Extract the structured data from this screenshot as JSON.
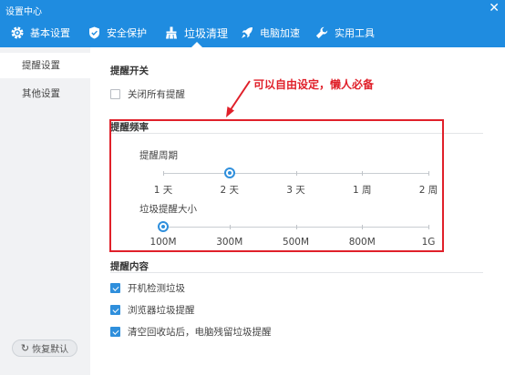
{
  "window": {
    "title": "设置中心",
    "close_glyph": "✕"
  },
  "tabs": [
    {
      "label": "基本设置",
      "icon": "gear-icon"
    },
    {
      "label": "安全保护",
      "icon": "shield-icon"
    },
    {
      "label": "垃圾清理",
      "icon": "broom-icon",
      "active": true
    },
    {
      "label": "电脑加速",
      "icon": "rocket-icon"
    },
    {
      "label": "实用工具",
      "icon": "wrench-icon"
    }
  ],
  "sidebar": {
    "items": [
      {
        "label": "提醒设置",
        "active": true
      },
      {
        "label": "其他设置"
      }
    ],
    "reset_icon": "↻",
    "reset_label": "恢复默认"
  },
  "sections": {
    "switch": {
      "title": "提醒开关",
      "close_all_label": "关闭所有提醒",
      "close_all_checked": false
    },
    "frequency": {
      "title": "提醒频率",
      "period_label": "提醒周期",
      "period_ticks": [
        "1 天",
        "2 天",
        "3 天",
        "1 周",
        "2 周"
      ],
      "period_selected": "2 天",
      "size_label": "垃圾提醒大小",
      "size_ticks": [
        "100M",
        "300M",
        "500M",
        "800M",
        "1G"
      ],
      "size_selected": "100M"
    },
    "content": {
      "title": "提醒内容",
      "items": [
        {
          "label": "开机检测垃圾",
          "checked": true
        },
        {
          "label": "浏览器垃圾提醒",
          "checked": true
        },
        {
          "label": "清空回收站后，电脑残留垃圾提醒",
          "checked": true
        }
      ]
    }
  },
  "annotation": {
    "text": "可以自由设定，懒人必备",
    "color": "#e0202a"
  },
  "colors": {
    "accent": "#1f8ce0",
    "knob": "#2f8fdc"
  }
}
